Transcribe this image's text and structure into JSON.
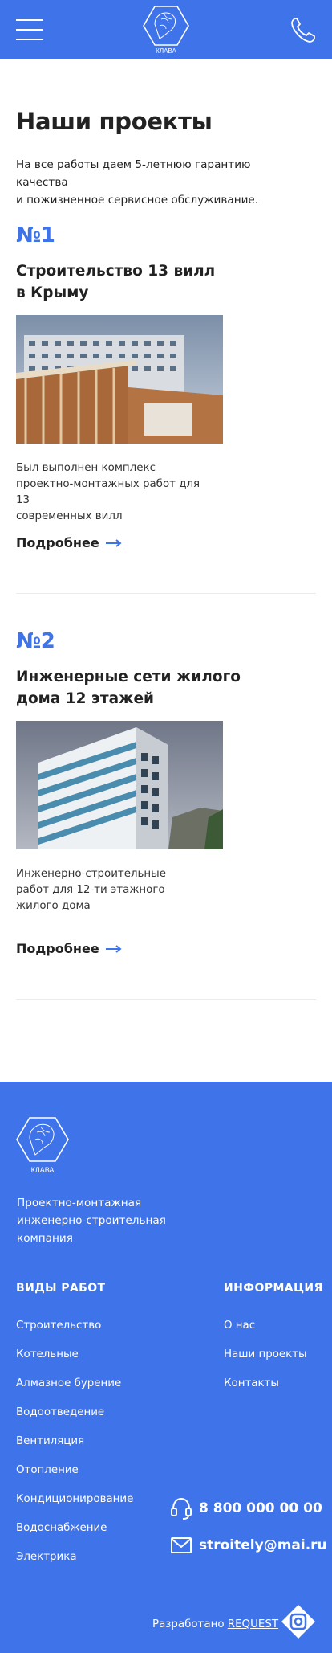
{
  "header": {
    "logo_text": "КЛАВА",
    "menu_icon": "hamburger-icon",
    "phone_icon": "phone-icon"
  },
  "page": {
    "title": "Наши проекты",
    "intro_line1": "На все работы даем 5-летнюю гарантию качества",
    "intro_line2": "и пожизненное сервисное обслуживание."
  },
  "projects": [
    {
      "number": "№1",
      "title_line1": "Строительство 13 вилл",
      "title_line2": "в Крыму",
      "desc_line1": "Был выполнен комплекс",
      "desc_line2": "проектно-монтажных работ для 13",
      "desc_line3": "современных вилл",
      "more_label": "Подробнее"
    },
    {
      "number": "№2",
      "title_line1": "Инженерные сети жилого",
      "title_line2": "дома 12 этажей",
      "desc_line1": "Инженерно-строительные",
      "desc_line2": "работ для 12-ти этажного",
      "desc_line3": "жилого дома",
      "more_label": "Подробнее"
    }
  ],
  "footer": {
    "logo_text": "КЛАВА",
    "tagline_line1": "Проектно-монтажная",
    "tagline_line2": "инженерно-строительная",
    "tagline_line3": "компания",
    "works_title": "ВИДЫ РАБОТ",
    "works": [
      "Строительство",
      "Котельные",
      "Алмазное бурение",
      "Водоотведение",
      "Вентиляция",
      "Отопление",
      "Кондиционирование",
      "Водоснабжение",
      "Электрика"
    ],
    "info_title": "ИНФОРМАЦИЯ",
    "info": [
      "О нас",
      "Наши проекты",
      "Контакты"
    ],
    "phone": "8 800 000 00 00",
    "email": "stroitely@mai.ru",
    "dev_prefix": "Разработано",
    "dev_link": "REQUEST"
  },
  "colors": {
    "accent": "#3e73ea",
    "text": "#222222"
  }
}
